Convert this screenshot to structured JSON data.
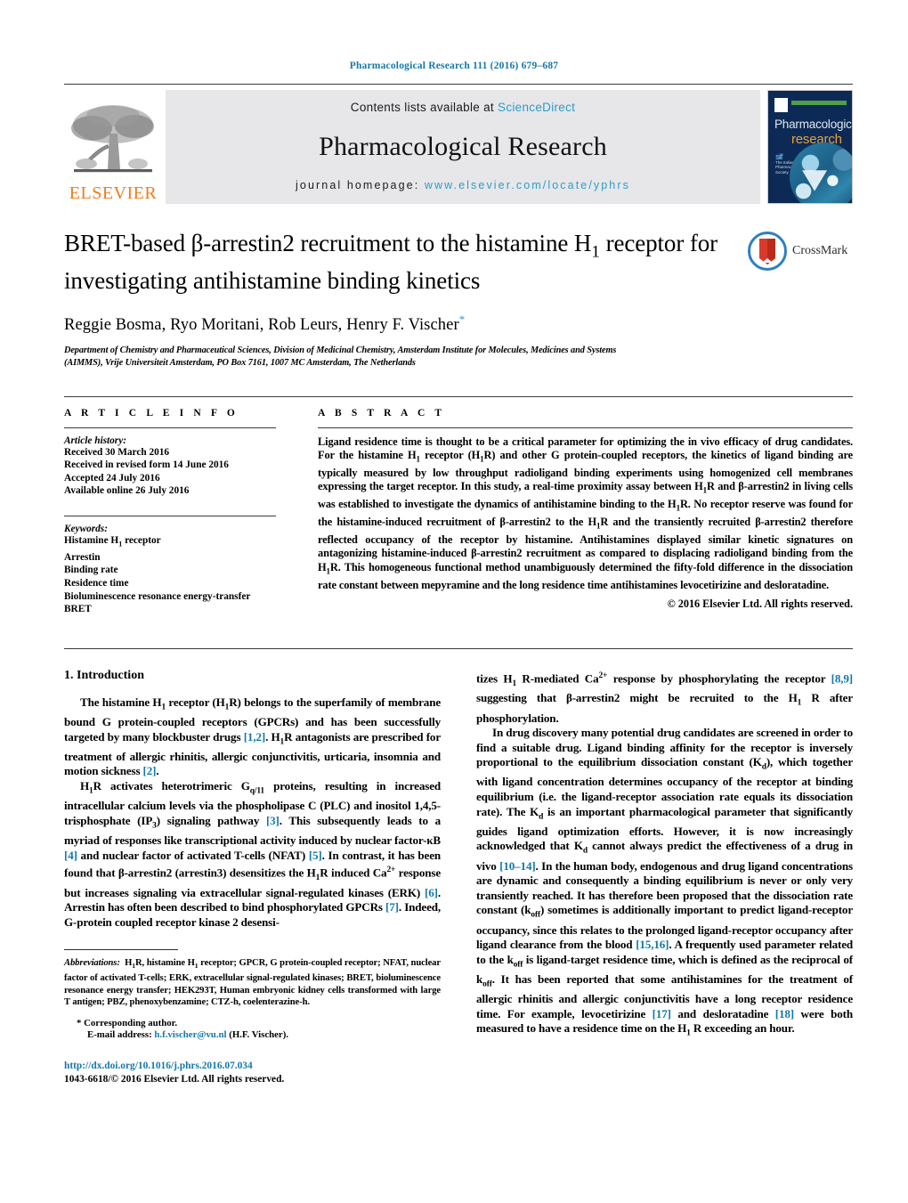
{
  "running_head": "Pharmacological Research 111 (2016) 679–687",
  "masthead": {
    "publisher_name": "ELSEVIER",
    "contents_prefix": "Contents lists available at ",
    "contents_link": "ScienceDirect",
    "journal_title": "Pharmacological Research",
    "homepage_prefix": "journal homepage: ",
    "homepage_url": "www.elsevier.com/locate/yphrs",
    "cover": {
      "line1": "Pharmacological",
      "line2": "research",
      "society": "The Italian\nPharmacological\nSociety"
    }
  },
  "article": {
    "title_line1": "BRET-based β-arrestin2 recruitment to the histamine H",
    "title_sub1": "1",
    "title_line1b": " receptor for",
    "title_line2": "investigating antihistamine binding kinetics",
    "crossmark_label": "CrossMark",
    "authors": "Reggie Bosma, Ryo Moritani, Rob Leurs, Henry F. Vischer",
    "corresponding_marker": "*",
    "affiliation_line1": "Department of Chemistry and Pharmaceutical Sciences, Division of Medicinal Chemistry, Amsterdam Institute for Molecules, Medicines and Systems",
    "affiliation_line2": "(AIMMS), Vrije Universiteit Amsterdam, PO Box 7161, 1007 MC Amsterdam, The Netherlands"
  },
  "article_info": {
    "heading": "A R T I C L E   I N F O",
    "history_label": "Article history:",
    "history": [
      "Received 30 March 2016",
      "Received in revised form 14 June 2016",
      "Accepted 24 July 2016",
      "Available online 26 July 2016"
    ],
    "keywords_label": "Keywords:",
    "keywords": [
      "Histamine H1 receptor",
      "Arrestin",
      "Binding rate",
      "Residence time",
      "Bioluminescence resonance energy-transfer",
      "BRET"
    ]
  },
  "abstract": {
    "heading": "A B S T R A C T",
    "text": "Ligand residence time is thought to be a critical parameter for optimizing the in vivo efficacy of drug candidates. For the histamine H1 receptor (H1R) and other G protein-coupled receptors, the kinetics of ligand binding are typically measured by low throughput radioligand binding experiments using homogenized cell membranes expressing the target receptor. In this study, a real-time proximity assay between H1R and β-arrestin2 in living cells was established to investigate the dynamics of antihistamine binding to the H1R. No receptor reserve was found for the histamine-induced recruitment of β-arrestin2 to the H1R and the transiently recruited β-arrestin2 therefore reflected occupancy of the receptor by histamine. Antihistamines displayed similar kinetic signatures on antagonizing histamine-induced β-arrestin2 recruitment as compared to displacing radioligand binding from the H1R. This homogeneous functional method unambiguously determined the fifty-fold difference in the dissociation rate constant between mepyramine and the long residence time antihistamines levocetirizine and desloratadine.",
    "copyright": "© 2016 Elsevier Ltd. All rights reserved."
  },
  "introduction": {
    "heading": "1.  Introduction",
    "para1": "The histamine H1 receptor (H1R) belongs to the superfamily of membrane bound G protein-coupled receptors (GPCRs) and has been successfully targeted by many blockbuster drugs [1,2]. H1R antagonists are prescribed for treatment of allergic rhinitis, allergic conjunctivitis, urticaria, insomnia and motion sickness [2].",
    "para2": "H1R activates heterotrimeric Gq/11 proteins, resulting in increased intracellular calcium levels via the phospholipase C (PLC) and inositol 1,4,5-trisphosphate (IP3) signaling pathway [3]. This subsequently leads to a myriad of responses like transcriptional activity induced by nuclear factor-κB [4] and nuclear factor of activated T-cells (NFAT) [5]. In contrast, it has been found that β-arrestin2 (arrestin3) desensitizes the H1R induced Ca2+ response but increases signaling via extracellular signal-regulated kinases (ERK) [6]. Arrestin has often been described to bind phosphorylated GPCRs [7]. Indeed, G-protein coupled receptor kinase 2 desensitizes H1R-mediated Ca2+ response by phosphorylating the receptor [8,9] suggesting that β-arrestin2 might be recruited to the H1R after phosphorylation.",
    "para3": "In drug discovery many potential drug candidates are screened in order to find a suitable drug. Ligand binding affinity for the receptor is inversely proportional to the equilibrium dissociation constant (Kd), which together with ligand concentration determines occupancy of the receptor at binding equilibrium (i.e. the ligand-receptor association rate equals its dissociation rate). The Kd is an important pharmacological parameter that significantly guides ligand optimization efforts. However, it is now increasingly acknowledged that Kd cannot always predict the effectiveness of a drug in vivo [10–14]. In the human body, endogenous and drug ligand concentrations are dynamic and consequently a binding equilibrium is never or only very transiently reached. It has therefore been proposed that the dissociation rate constant (koff) sometimes is additionally important to predict ligand-receptor occupancy, since this relates to the prolonged ligand-receptor occupancy after ligand clearance from the blood [15,16]. A frequently used parameter related to the koff is ligand-target residence time, which is defined as the reciprocal of koff. It has been reported that some antihistamines for the treatment of allergic rhinitis and allergic conjunctivitis have a long receptor residence time. For example, levocetirizine [17] and desloratadine [18] were both measured to have a residence time on the H1R exceeding an hour."
  },
  "footnotes": {
    "abbreviations_label": "Abbreviations:",
    "abbreviations_text": "H1R, histamine H1 receptor; GPCR, G protein-coupled receptor; NFAT, nuclear factor of activated T-cells; ERK, extracellular signal-regulated kinases; BRET, bioluminescence resonance energy transfer; HEK293T, Human embryonic kidney cells transformed with large T antigen; PBZ, phenoxybenzamine; CTZ-h, coelenterazine-h.",
    "corresponding": "* Corresponding author.",
    "email_label": "E-mail address:",
    "email": "h.f.vischer@vu.nl",
    "email_suffix": "(H.F. Vischer).",
    "doi": "http://dx.doi.org/10.1016/j.phrs.2016.07.034",
    "issn_line": "1043-6618/© 2016 Elsevier Ltd. All rights reserved."
  },
  "colors": {
    "link": "#1478a8",
    "sciencedirect": "#2d9cc8",
    "elsevier_orange": "#f07c1a",
    "banner_bg": "#e7e7e9",
    "cover_navy": "#0d2a56"
  }
}
